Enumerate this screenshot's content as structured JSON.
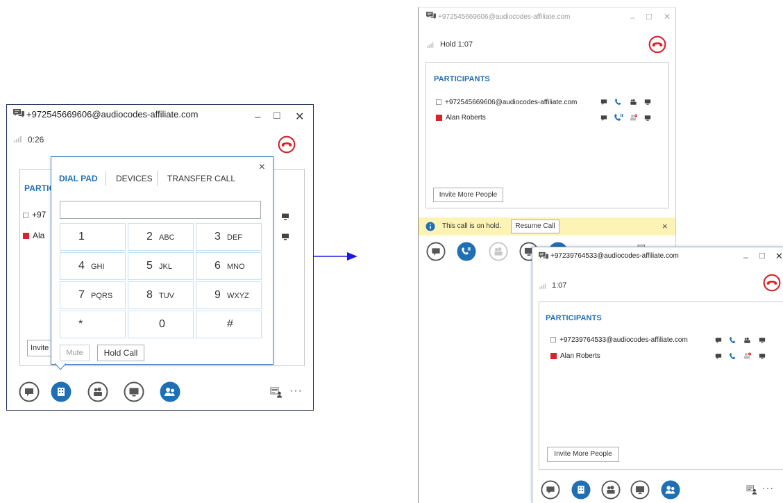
{
  "window1": {
    "title": "+972545669606@audiocodes-affiliate.com",
    "timer": "0:26",
    "panel_header_partial": "PARTIC",
    "participant1_partial": "+97",
    "participant2_partial": "Ala",
    "invite_partial": "Invite",
    "dialpad": {
      "tabs": [
        "DIAL PAD",
        "DEVICES",
        "TRANSFER CALL"
      ],
      "close": "×",
      "number_input": "",
      "keys": [
        {
          "digit": "1",
          "letters": ""
        },
        {
          "digit": "2",
          "letters": "ABC"
        },
        {
          "digit": "3",
          "letters": "DEF"
        },
        {
          "digit": "4",
          "letters": "GHI"
        },
        {
          "digit": "5",
          "letters": "JKL"
        },
        {
          "digit": "6",
          "letters": "MNO"
        },
        {
          "digit": "7",
          "letters": "PQRS"
        },
        {
          "digit": "8",
          "letters": "TUV"
        },
        {
          "digit": "9",
          "letters": "WXYZ"
        },
        {
          "digit": "*",
          "letters": ""
        },
        {
          "digit": "0",
          "letters": ""
        },
        {
          "digit": "#",
          "letters": ""
        }
      ],
      "mute": "Mute",
      "hold": "Hold Call"
    },
    "more": "···"
  },
  "window2": {
    "title": "+972545669606@audiocodes-affiliate.com",
    "timer": "Hold 1:07",
    "participants_header": "PARTICIPANTS",
    "participants": [
      "+972545669606@audiocodes-affiliate.com",
      "Alan Roberts"
    ],
    "invite": "Invite More People",
    "hold_notice": "This call is on hold.",
    "resume": "Resume Call",
    "close_notice": "×"
  },
  "window3": {
    "title": "+97239764533@audiocodes-affiliate.com",
    "timer": "1:07",
    "participants_header": "PARTICIPANTS",
    "participants": [
      "+97239764533@audiocodes-affiliate.com",
      "Alan Roberts"
    ],
    "invite": "Invite More People",
    "more": "···"
  },
  "colors": {
    "accent": "#1f6fb5",
    "hangup_red": "#d8232a",
    "notice_bg": "#fdf3b4",
    "arrow": "#1a1adf"
  },
  "icons": [
    "im-icon",
    "phone-icon",
    "video-icon",
    "present-icon",
    "people-icon",
    "dialpad-icon",
    "hangup-icon",
    "info-icon",
    "participant-list-icon"
  ]
}
